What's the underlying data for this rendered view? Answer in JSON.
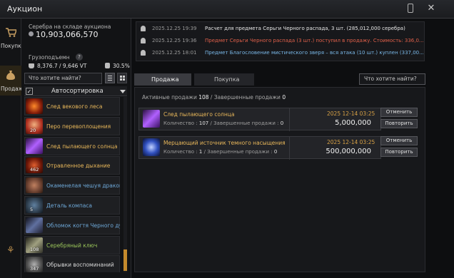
{
  "window": {
    "title": "Аукцион"
  },
  "nav": {
    "buy_label": "Покупка",
    "sell_label": "Продажа"
  },
  "inventory": {
    "silver_label": "Серебра на складе аукциона",
    "silver_value": "10,903,066,570",
    "weight_label": "Грузоподъемн",
    "weight_value": "8,376.7 / 9,646 VT",
    "weight_percent": "30.5%",
    "search_placeholder": "Что хотите найти?",
    "autosort_label": "Автосортировка",
    "items": [
      {
        "name": "След векового леса",
        "qty": "",
        "name_color": "#e8b75a",
        "icon": "red-orb-icon"
      },
      {
        "name": "Перо перевоплощения",
        "qty": "20",
        "name_color": "#e8b75a",
        "icon": "feather-icon"
      },
      {
        "name": "След пылающего солнца",
        "qty": "",
        "name_color": "#e8b75a",
        "icon": "purple-crystal-icon"
      },
      {
        "name": "Отравленное дыхание",
        "qty": "462",
        "name_color": "#e8b75a",
        "icon": "poison-flask-icon"
      },
      {
        "name": "Окаменелая чешуя дракона",
        "qty": "",
        "name_color": "#6ea8d8",
        "icon": "dragon-scale-icon"
      },
      {
        "name": "Деталь компаса",
        "qty": "5",
        "name_color": "#6ea8d8",
        "icon": "compass-part-icon"
      },
      {
        "name": "Обломок когтя Черного духа",
        "qty": "",
        "name_color": "#6ea8d8",
        "icon": "claw-icon"
      },
      {
        "name": "Серебряный ключ",
        "qty": "108",
        "name_color": "#9bc65a",
        "icon": "silver-key-icon"
      },
      {
        "name": "Обрывки воспоминаний",
        "qty": "347",
        "name_color": "#d8d8d8",
        "icon": "memory-fragment-icon"
      }
    ]
  },
  "notifications": [
    {
      "time": "2025.12.25 19:39",
      "text": "Расчет для предмета Серьги Черного распада, 3 шт. (285,012,000 серебра)",
      "color": "#e8e8e8"
    },
    {
      "time": "2025.12.25 19:36",
      "text": "Предмет Серьги Черного распада (3 шт.) поступил в продажу. Стоимость: 336,0...",
      "color": "#e0604a"
    },
    {
      "time": "2025.12.25 18:01",
      "text": "Предмет Благословение мистического зверя – вся атака (10 шт.) куплен (337,00...",
      "color": "#7ab8e8"
    }
  ],
  "tabs": {
    "sell": "Продажа",
    "buy": "Покупка"
  },
  "search_placeholder": "Что хотите найти?",
  "sales": {
    "active_label": "Активные продажи",
    "active_count": "108",
    "completed_label": "Завершенные продажи",
    "completed_count": "0",
    "listings": [
      {
        "name": "След пылающего солнца",
        "qty_label": "Количество :",
        "qty": "107",
        "done_label": "Завершенные продажи :",
        "done": "0",
        "date": "2025 12-14 03:25",
        "price": "5,000,000",
        "cancel": "Отменить",
        "repeat": "Повторить"
      },
      {
        "name": "Мерцающий источник темного насыщения",
        "qty_label": "Количество :",
        "qty": "1",
        "done_label": "Завершенные продажи :",
        "done": "0",
        "date": "2025 12-14 03:25",
        "price": "500,000,000",
        "cancel": "Отменить",
        "repeat": "Повторить"
      }
    ]
  }
}
